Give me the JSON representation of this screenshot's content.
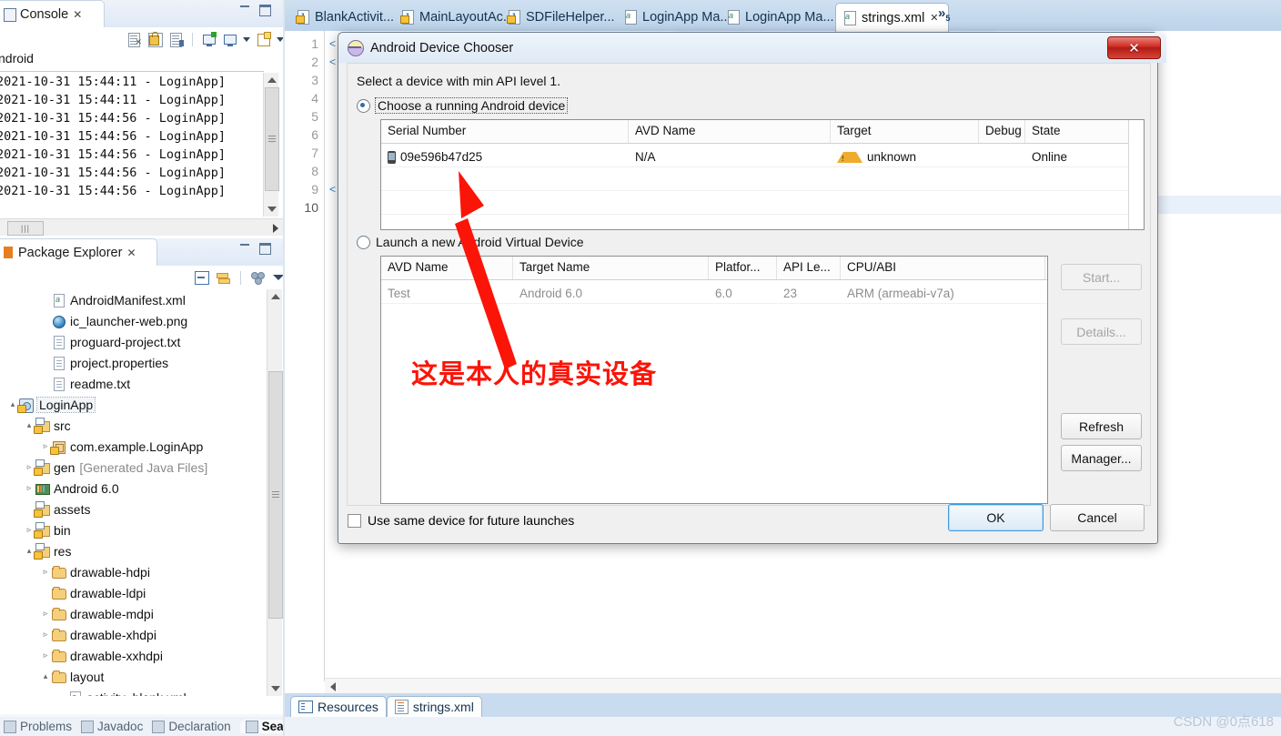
{
  "console": {
    "tab_label": "Console",
    "close_glyph": "✕",
    "title": "ndroid",
    "log_lines": [
      "2021-10-31 15:44:11 - LoginApp]",
      "2021-10-31 15:44:11 - LoginApp]",
      "2021-10-31 15:44:56 - LoginApp]",
      "2021-10-31 15:44:56 - LoginApp]",
      "2021-10-31 15:44:56 - LoginApp]",
      "2021-10-31 15:44:56 - LoginApp]",
      "2021-10-31 15:44:56 - LoginApp]"
    ],
    "toolbar_icons": [
      "clear-console-icon",
      "scroll-lock-icon",
      "show-console-when-output-icon",
      "pin-console-icon",
      "display-selected-console-icon",
      "display-selected-console-dropdown-icon",
      "open-console-icon",
      "open-console-dropdown-icon"
    ]
  },
  "package_explorer": {
    "tab_label": "Package Explorer",
    "close_glyph": "✕",
    "toolbar_icons": [
      "collapse-all-icon",
      "link-with-editor-icon",
      "view-menu-icon",
      "view-dropdown-icon"
    ],
    "tree": [
      {
        "indent": 2,
        "twist": "",
        "icon": "xml-file-icon",
        "label": "AndroidManifest.xml",
        "dim": false,
        "selected": false
      },
      {
        "indent": 2,
        "twist": "",
        "icon": "png-file-icon",
        "label": "ic_launcher-web.png",
        "dim": false,
        "selected": false
      },
      {
        "indent": 2,
        "twist": "",
        "icon": "text-file-icon",
        "label": "proguard-project.txt",
        "dim": false,
        "selected": false
      },
      {
        "indent": 2,
        "twist": "",
        "icon": "text-file-icon",
        "label": "project.properties",
        "dim": false,
        "selected": false
      },
      {
        "indent": 2,
        "twist": "",
        "icon": "text-file-icon",
        "label": "readme.txt",
        "dim": false,
        "selected": false
      },
      {
        "indent": 0,
        "twist": "▴",
        "icon": "project-icon",
        "label": "LoginApp",
        "dim": false,
        "selected": true
      },
      {
        "indent": 1,
        "twist": "▴",
        "icon": "source-folder-icon",
        "label": "src",
        "dim": false,
        "selected": false
      },
      {
        "indent": 2,
        "twist": "▹",
        "icon": "package-icon",
        "label": "com.example.LoginApp",
        "dim": false,
        "selected": false
      },
      {
        "indent": 1,
        "twist": "▹",
        "icon": "source-folder-icon",
        "label": "gen",
        "suffix": "[Generated Java Files]",
        "dim": false,
        "selected": false
      },
      {
        "indent": 1,
        "twist": "▹",
        "icon": "library-icon",
        "label": "Android 6.0",
        "dim": false,
        "selected": false
      },
      {
        "indent": 1,
        "twist": "",
        "icon": "source-folder-icon",
        "label": "assets",
        "dim": false,
        "selected": false
      },
      {
        "indent": 1,
        "twist": "▹",
        "icon": "source-folder-icon",
        "label": "bin",
        "dim": false,
        "selected": false
      },
      {
        "indent": 1,
        "twist": "▴",
        "icon": "source-folder-icon",
        "label": "res",
        "dim": false,
        "selected": false
      },
      {
        "indent": 2,
        "twist": "▹",
        "icon": "folder-icon",
        "label": "drawable-hdpi",
        "dim": false,
        "selected": false
      },
      {
        "indent": 2,
        "twist": "",
        "icon": "folder-icon",
        "label": "drawable-ldpi",
        "dim": false,
        "selected": false
      },
      {
        "indent": 2,
        "twist": "▹",
        "icon": "folder-icon",
        "label": "drawable-mdpi",
        "dim": false,
        "selected": false
      },
      {
        "indent": 2,
        "twist": "▹",
        "icon": "folder-icon",
        "label": "drawable-xhdpi",
        "dim": false,
        "selected": false
      },
      {
        "indent": 2,
        "twist": "▹",
        "icon": "folder-icon",
        "label": "drawable-xxhdpi",
        "dim": false,
        "selected": false
      },
      {
        "indent": 2,
        "twist": "▴",
        "icon": "folder-icon",
        "label": "layout",
        "dim": false,
        "selected": false
      },
      {
        "indent": 3,
        "twist": "",
        "icon": "xml-file-icon",
        "label": "activity_blank.xml",
        "dim": false,
        "selected": false
      }
    ]
  },
  "bottom_view_tabs": [
    {
      "label": "Problems",
      "active": false
    },
    {
      "label": "Javadoc",
      "active": false
    },
    {
      "label": "Declaration",
      "active": false
    },
    {
      "label": "Search",
      "active": true
    }
  ],
  "editor": {
    "tabs": [
      {
        "label": "BlankActivit...",
        "icon": "java-file-icon",
        "active": false,
        "close": ""
      },
      {
        "label": "MainLayoutAc...",
        "icon": "java-file-icon",
        "active": false,
        "close": ""
      },
      {
        "label": "SDFileHelper...",
        "icon": "java-file-icon",
        "active": false,
        "close": ""
      },
      {
        "label": "LoginApp Ma...",
        "icon": "xml-file-icon",
        "active": false,
        "close": ""
      },
      {
        "label": "LoginApp Ma...",
        "icon": "xml-file-icon",
        "active": false,
        "close": ""
      },
      {
        "label": "strings.xml",
        "icon": "xml-file-icon",
        "active": true,
        "close": "✕"
      }
    ],
    "more_tabs_indicator": "»",
    "more_tabs_count": "5",
    "line_numbers": [
      "1",
      "2",
      "3",
      "4",
      "5",
      "6",
      "7",
      "8",
      "9",
      "10"
    ],
    "fold_markers": [
      {
        "line": 1,
        "glyph": "<"
      },
      {
        "line": 2,
        "glyph": "<"
      },
      {
        "line": 9,
        "glyph": "<"
      }
    ],
    "bottom_tabs": [
      {
        "label": "Resources",
        "icon": "resources-icon",
        "active": true
      },
      {
        "label": "strings.xml",
        "icon": "strings-xml-icon",
        "active": true
      }
    ]
  },
  "dialog": {
    "title": "Android Device Chooser",
    "title_icon": "android-device-chooser-icon",
    "close_label": "✕",
    "instruction": "Select a device with min API level 1.",
    "running_device_radio": {
      "label": "Choose a running Android device",
      "selected": true
    },
    "running_devices_table": {
      "columns": [
        "Serial Number",
        "AVD Name",
        "Target",
        "Debug",
        "State"
      ],
      "rows": [
        {
          "serial": "09e596b47d25",
          "avd_name": "N/A",
          "target": "unknown",
          "target_warning": true,
          "debug": "",
          "state": "Online"
        }
      ]
    },
    "new_avd_radio": {
      "label": "Launch a new Android Virtual Device",
      "selected": false
    },
    "avd_table": {
      "columns": [
        "AVD Name",
        "Target Name",
        "Platfor...",
        "API Le...",
        "CPU/ABI"
      ],
      "rows": [
        {
          "avd_name": "Test",
          "target_name": "Android 6.0",
          "platform": "6.0",
          "api_level": "23",
          "cpu_abi": "ARM (armeabi-v7a)"
        }
      ]
    },
    "side_buttons": [
      {
        "label": "Start...",
        "disabled": true
      },
      {
        "label": "Details...",
        "disabled": true
      },
      {
        "label": "Refresh",
        "disabled": false
      },
      {
        "label": "Manager...",
        "disabled": false
      }
    ],
    "use_same_device_checkbox": {
      "label": "Use same device for future launches",
      "checked": false
    },
    "ok_button": "OK",
    "cancel_button": "Cancel"
  },
  "annotation": {
    "text": "这是本人的真实设备",
    "color": "#fb1408",
    "arrow_name": "red-pointer-arrow"
  },
  "watermark": "CSDN @0点618"
}
